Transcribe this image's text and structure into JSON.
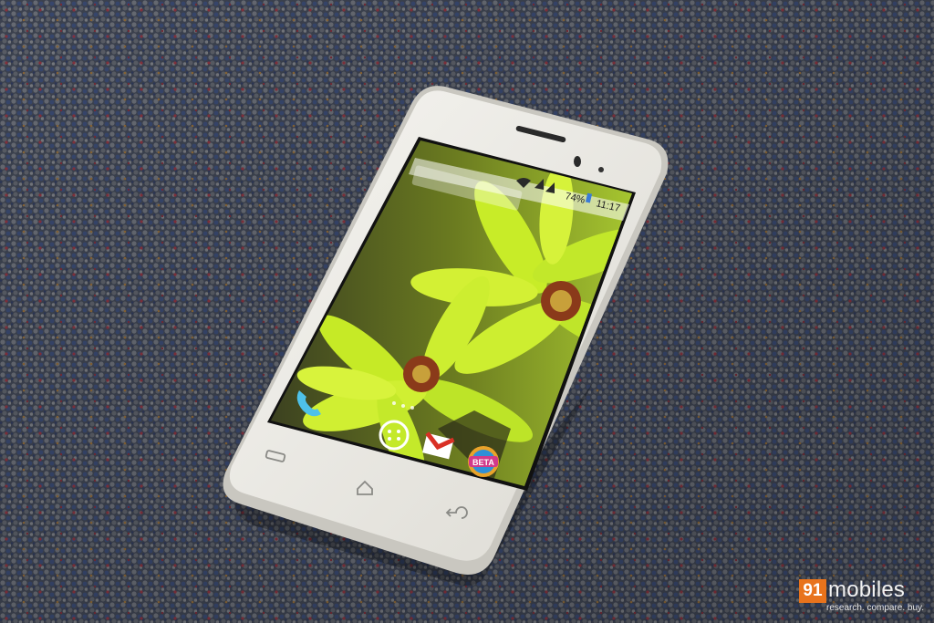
{
  "status_bar": {
    "battery": "74%",
    "time": "11:17"
  },
  "dock": {
    "beta_badge": "BETA"
  },
  "watermark": {
    "number": "91",
    "word": "mobiles",
    "tagline": "research. compare. buy."
  },
  "colors": {
    "phone_body": "#ecebe6",
    "carpet": "#4a4f5c",
    "flower": "#c8ec28",
    "flower_center": "#8a3a1a",
    "watermark_accent": "#e8731c"
  }
}
